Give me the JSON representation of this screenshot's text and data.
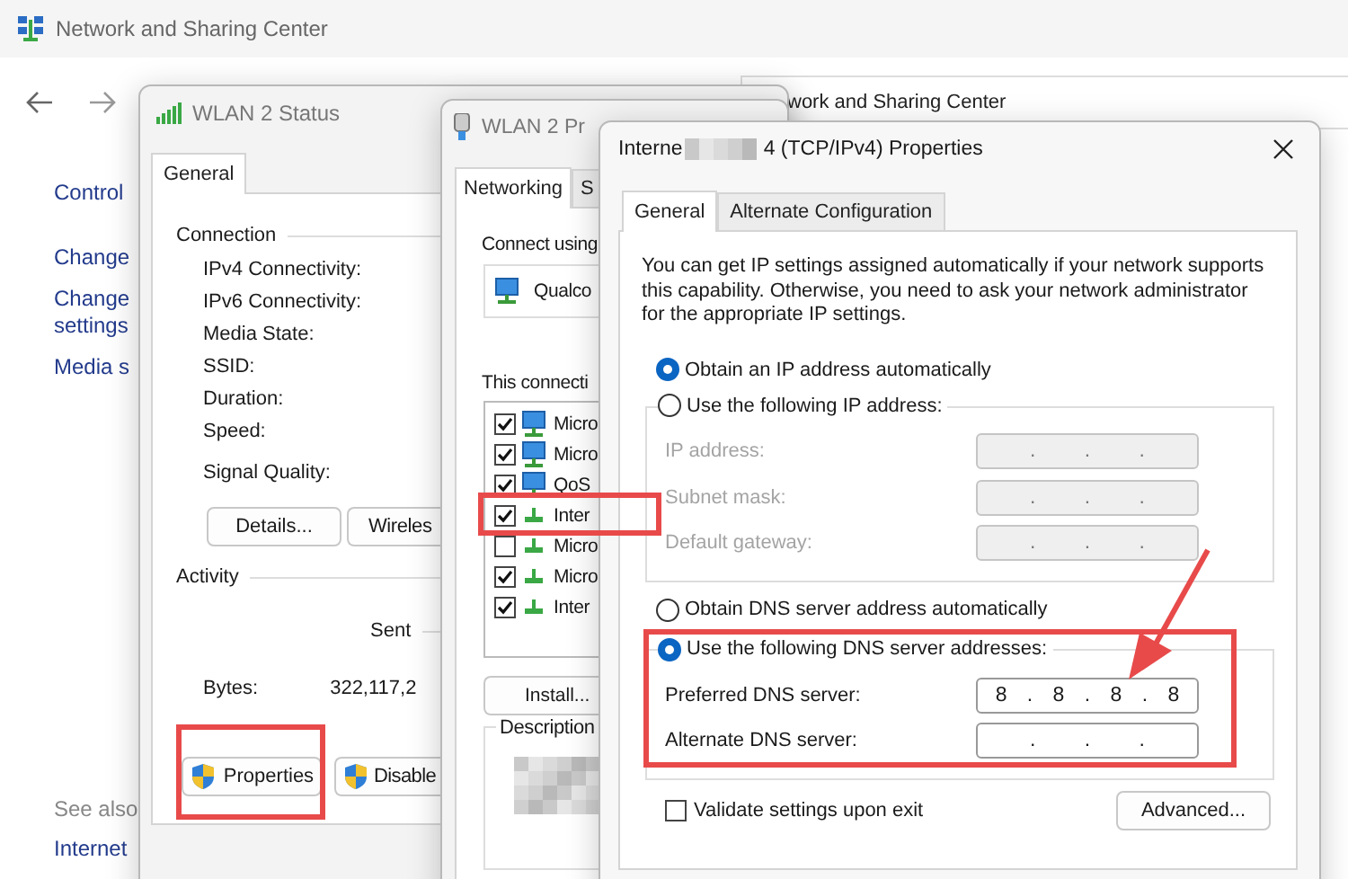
{
  "background_window": {
    "title": "Network and Sharing Center",
    "address_text": "work and Sharing Center",
    "home_link": "Control",
    "task_links": [
      [
        "Change"
      ],
      [
        "Change",
        "settings"
      ],
      [
        "Media s"
      ]
    ],
    "see_also_heading": "See also",
    "see_also_links": [
      "Internet"
    ]
  },
  "status_window": {
    "title": "WLAN 2 Status",
    "tabs": [
      {
        "label": "General",
        "selected": true
      }
    ],
    "connection_heading": "Connection",
    "connection_fields": [
      "IPv4 Connectivity:",
      "IPv6 Connectivity:",
      "Media State:",
      "SSID:",
      "Duration:",
      "Speed:"
    ],
    "signal_label": "Signal Quality:",
    "buttons": [
      "Details...",
      "Wireles"
    ],
    "activity_heading": "Activity",
    "sent_label": "Sent",
    "bytes_label": "Bytes:",
    "bytes_sent": "322,117,2",
    "admin_buttons": [
      "Properties",
      "Disable"
    ]
  },
  "properties_window": {
    "title": "WLAN 2 Pr",
    "tabs": [
      {
        "label": "Networking",
        "selected": true
      },
      {
        "label": "S",
        "selected": false
      }
    ],
    "connect_using_label": "Connect using",
    "adapter": "Qualco",
    "components_label": "This connecti",
    "components": [
      {
        "kind": "client",
        "name": "Micro",
        "checked": true
      },
      {
        "kind": "client",
        "name": "Micro",
        "checked": true
      },
      {
        "kind": "client",
        "name": "QoS",
        "checked": true
      },
      {
        "kind": "protocol",
        "name": "Inter",
        "checked": true
      },
      {
        "kind": "protocol",
        "name": "Micro",
        "checked": false
      },
      {
        "kind": "protocol",
        "name": "Micro",
        "checked": true
      },
      {
        "kind": "protocol",
        "name": "Inter",
        "checked": true
      }
    ],
    "install_button": "Install...",
    "description_heading": "Description"
  },
  "ipv4_dialog": {
    "title_start": "Interne",
    "title_end": "4 (TCP/IPv4) Properties",
    "tabs": [
      {
        "label": "General",
        "selected": true
      },
      {
        "label": "Alternate Configuration",
        "selected": false
      }
    ],
    "intro": "You can get IP settings assigned automatically if your network supports this capability. Otherwise, you need to ask your network administrator for the appropriate IP settings.",
    "ip_options": [
      {
        "label": "Obtain an IP address automatically",
        "selected": true
      },
      {
        "label": "Use the following IP address:",
        "selected": false
      }
    ],
    "ip_fields": [
      {
        "label": "IP address:",
        "text": ". . .",
        "disabled": true
      },
      {
        "label": "Subnet mask:",
        "text": ". . .",
        "disabled": true
      },
      {
        "label": "Default gateway:",
        "text": ". . .",
        "disabled": true
      }
    ],
    "dns_options": [
      {
        "label": "Obtain DNS server address automatically",
        "selected": false
      },
      {
        "label": "Use the following DNS server addresses:",
        "selected": true
      }
    ],
    "dns_fields": [
      {
        "label": "Preferred DNS server:",
        "text": "8 . 8 . 8 . 8",
        "disabled": false
      },
      {
        "label": "Alternate DNS server:",
        "text": ". . .",
        "disabled": false
      }
    ],
    "validate": {
      "label": "Validate settings upon exit",
      "checked": false
    },
    "advanced_button": "Advanced..."
  }
}
